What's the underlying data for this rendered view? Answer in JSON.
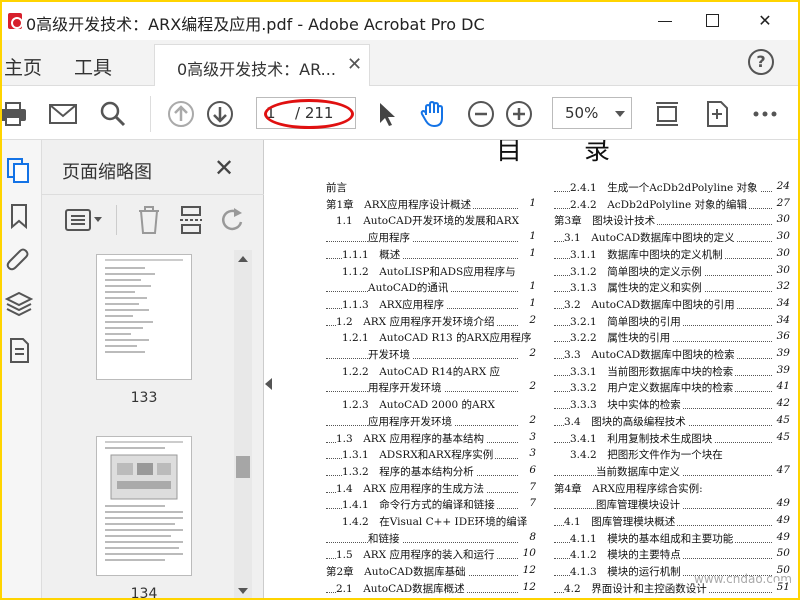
{
  "window": {
    "title": "0高级开发技术：ARX编程及应用.pdf - Adobe Acrobat Pro DC",
    "min_label": "",
    "max_label": "",
    "close_label": "✕"
  },
  "tabs": {
    "home": "主页",
    "tools": "工具",
    "doc_tab": "0高级开发技术：AR...",
    "doc_tab_close": "✕",
    "help": "?"
  },
  "toolbar": {
    "page_current": "1",
    "page_total": "/ 211",
    "zoom": "50%",
    "icons": [
      "print-icon",
      "email-icon",
      "search-icon",
      "prev-page-icon",
      "next-page-icon",
      "select-arrow-icon",
      "hand-icon",
      "zoom-out-icon",
      "zoom-in-icon",
      "fit-page-icon",
      "scroll-mode-icon",
      "more-icon"
    ],
    "accent": "#1473e6",
    "highlight_color": "#e01010"
  },
  "left_rail": {
    "icons": [
      "copy-pages-icon",
      "bookmark-icon",
      "attachment-icon",
      "layers-icon",
      "page-text-icon"
    ]
  },
  "thumbnails": {
    "title": "页面缩略图",
    "close": "✕",
    "pages": [
      {
        "label": "133"
      },
      {
        "label": "134"
      }
    ]
  },
  "document": {
    "heading": "目录",
    "toc_left": [
      {
        "text": "前言",
        "page": "",
        "level": 0
      },
      {
        "text": "第1章　ARX应用程序设计概述",
        "page": "1",
        "level": 0
      },
      {
        "text": "1.1　AutoCAD开发环境的发展和ARX",
        "page": "",
        "level": 1
      },
      {
        "text": "应用程序",
        "page": "1",
        "level": 3
      },
      {
        "text": "1.1.1　概述",
        "page": "1",
        "level": 2
      },
      {
        "text": "1.1.2　AutoLISP和ADS应用程序与",
        "page": "",
        "level": 2
      },
      {
        "text": "AutoCAD的通讯",
        "page": "1",
        "level": 3
      },
      {
        "text": "1.1.3　ARX应用程序",
        "page": "1",
        "level": 2
      },
      {
        "text": "1.2　ARX 应用程序开发环境介绍",
        "page": "2",
        "level": 1
      },
      {
        "text": "1.2.1　AutoCAD R13 的ARX应用程序",
        "page": "",
        "level": 2
      },
      {
        "text": "开发环境",
        "page": "2",
        "level": 3
      },
      {
        "text": "1.2.2　AutoCAD R14的ARX 应",
        "page": "",
        "level": 2
      },
      {
        "text": "用程序开发环境",
        "page": "2",
        "level": 3
      },
      {
        "text": "1.2.3　AutoCAD 2000 的ARX",
        "page": "",
        "level": 2
      },
      {
        "text": "应用程序开发环境",
        "page": "2",
        "level": 3
      },
      {
        "text": "1.3　ARX 应用程序的基本结构",
        "page": "3",
        "level": 1
      },
      {
        "text": "1.3.1　ADSRX和ARX程序实例",
        "page": "3",
        "level": 2
      },
      {
        "text": "1.3.2　程序的基本结构分析",
        "page": "6",
        "level": 2
      },
      {
        "text": "1.4　ARX 应用程序的生成方法",
        "page": "7",
        "level": 1
      },
      {
        "text": "1.4.1　命令行方式的编译和链接",
        "page": "7",
        "level": 2
      },
      {
        "text": "1.4.2　在Visual C++ IDE环境的编译",
        "page": "",
        "level": 2
      },
      {
        "text": "和链接",
        "page": "8",
        "level": 3
      },
      {
        "text": "1.5　ARX 应用程序的装入和运行",
        "page": "10",
        "level": 1
      },
      {
        "text": "第2章　AutoCAD数据库基础",
        "page": "12",
        "level": 0
      },
      {
        "text": "2.1　AutoCAD数据库概述",
        "page": "12",
        "level": 1
      }
    ],
    "toc_right": [
      {
        "text": "2.4.1　生成一个AcDb2dPolyline 对象",
        "page": "24",
        "level": 2
      },
      {
        "text": "2.4.2　AcDb2dPolyline 对象的编辑",
        "page": "27",
        "level": 2
      },
      {
        "text": "第3章　图块设计技术",
        "page": "30",
        "level": 0
      },
      {
        "text": "3.1　AutoCAD数据库中图块的定义",
        "page": "30",
        "level": 1
      },
      {
        "text": "3.1.1　数据库中图块的定义机制",
        "page": "30",
        "level": 2
      },
      {
        "text": "3.1.2　简单图块的定义示例",
        "page": "30",
        "level": 2
      },
      {
        "text": "3.1.3　属性块的定义和实例",
        "page": "32",
        "level": 2
      },
      {
        "text": "3.2　AutoCAD数据库中图块的引用",
        "page": "34",
        "level": 1
      },
      {
        "text": "3.2.1　简单图块的引用",
        "page": "34",
        "level": 2
      },
      {
        "text": "3.2.2　属性块的引用",
        "page": "36",
        "level": 2
      },
      {
        "text": "3.3　AutoCAD数据库中图块的检索",
        "page": "39",
        "level": 1
      },
      {
        "text": "3.3.1　当前图形数据库中块的检索",
        "page": "39",
        "level": 2
      },
      {
        "text": "3.3.2　用户定义数据库中块的检索",
        "page": "41",
        "level": 2
      },
      {
        "text": "3.3.3　块中实体的检索",
        "page": "42",
        "level": 2
      },
      {
        "text": "3.4　图块的高级编程技术",
        "page": "45",
        "level": 1
      },
      {
        "text": "3.4.1　利用复制技术生成图块",
        "page": "45",
        "level": 2
      },
      {
        "text": "3.4.2　把图形文件作为一个块在",
        "page": "",
        "level": 2
      },
      {
        "text": "当前数据库中定义",
        "page": "47",
        "level": 3
      },
      {
        "text": "第4章　ARX应用程序综合实例:",
        "page": "",
        "level": 0
      },
      {
        "text": "图库管理模块设计",
        "page": "49",
        "level": 3
      },
      {
        "text": "4.1　图库管理模块概述",
        "page": "49",
        "level": 1
      },
      {
        "text": "4.1.1　模块的基本组成和主要功能",
        "page": "49",
        "level": 2
      },
      {
        "text": "4.1.2　模块的主要特点",
        "page": "50",
        "level": 2
      },
      {
        "text": "4.1.3　模块的运行机制",
        "page": "50",
        "level": 2
      },
      {
        "text": "4.2　界面设计和主控函数设计",
        "page": "51",
        "level": 1
      }
    ],
    "watermark": "www.cndao.com"
  }
}
